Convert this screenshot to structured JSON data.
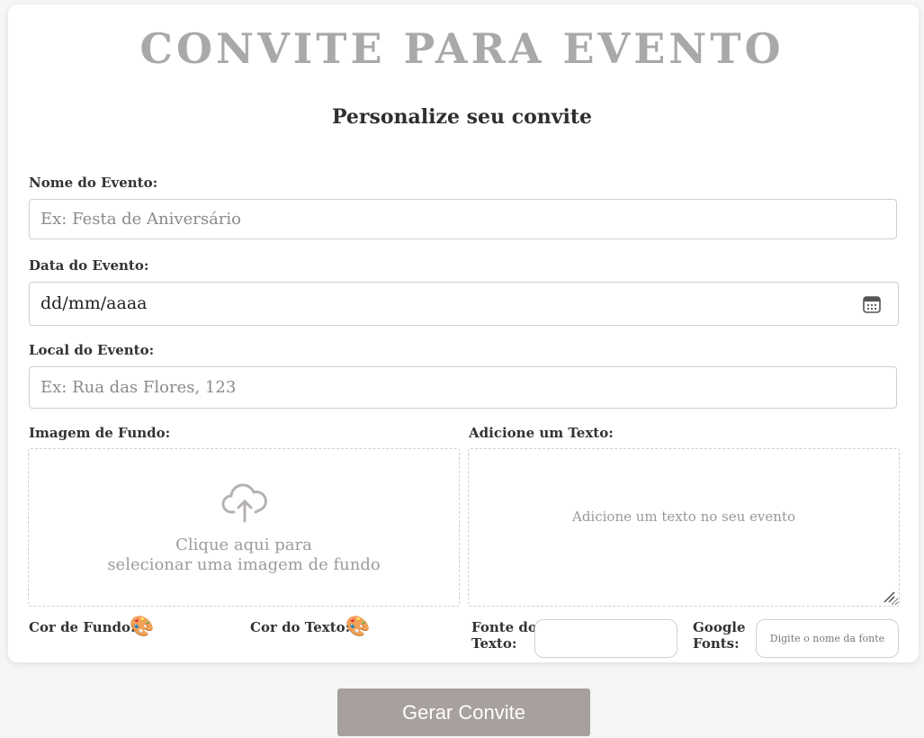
{
  "page": {
    "title": "CONVITE PARA EVENTO",
    "subtitle": "Personalize seu convite"
  },
  "form": {
    "event_name": {
      "label": "Nome do Evento:",
      "placeholder": "Ex: Festa de Aniversário",
      "value": ""
    },
    "event_date": {
      "label": "Data do Evento:",
      "display": "dd/mm/aaaa",
      "icon": "calendar-icon"
    },
    "event_place": {
      "label": "Local do Evento:",
      "placeholder": "Ex: Rua das Flores, 123",
      "value": ""
    },
    "background_image": {
      "label": "Imagem de Fundo:",
      "line1": "Clique aqui para",
      "line2": "selecionar uma imagem de fundo",
      "icon": "cloud-upload-icon"
    },
    "text": {
      "label": "Adicione um Texto:",
      "placeholder": "Adicione um texto no seu evento"
    },
    "bg_color": {
      "label": "Cor de Fundo:",
      "icon": "palette-icon"
    },
    "text_color": {
      "label": "Cor do Texto:",
      "icon": "palette-icon"
    },
    "text_font": {
      "label_line1": "Fonte do",
      "label_line2": "Texto:",
      "value": ""
    },
    "google_fonts": {
      "label_line1": "Google",
      "label_line2": "Fonts:",
      "placeholder": "Digite o nome da fonte"
    }
  },
  "actions": {
    "generate_label": "Gerar Convite"
  },
  "colors": {
    "title": "#a9a9a9",
    "button_bg": "#a7a09c",
    "page_bg": "#f6f6f6",
    "border": "#cfcfcf"
  }
}
